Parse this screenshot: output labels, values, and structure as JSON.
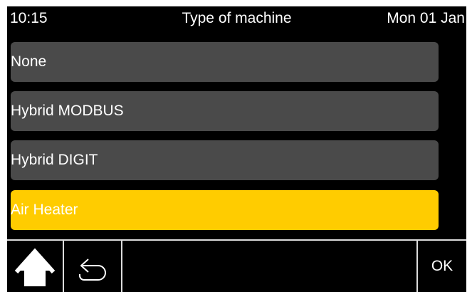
{
  "header": {
    "time": "10:15",
    "title": "Type of machine",
    "date": "Mon 01 Jan"
  },
  "options": [
    {
      "label": "None",
      "selected": false
    },
    {
      "label": "Hybrid MODBUS",
      "selected": false
    },
    {
      "label": "Hybrid DIGIT",
      "selected": false
    },
    {
      "label": "Air Heater",
      "selected": true
    }
  ],
  "footer": {
    "home_icon": "home-icon",
    "back_icon": "back-arrow-icon",
    "ok_label": "OK"
  },
  "colors": {
    "background": "#000000",
    "item": "#4a4a4a",
    "selected": "#ffcc00",
    "text": "#ffffff"
  }
}
